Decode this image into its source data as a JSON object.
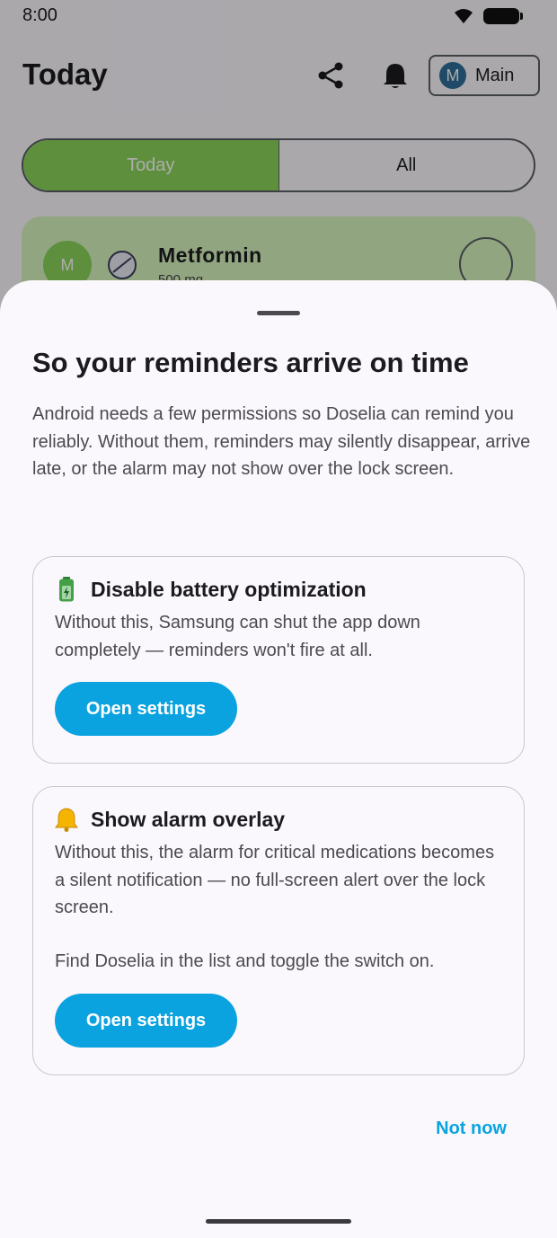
{
  "status_bar": {
    "time": "8:00"
  },
  "header": {
    "title": "Today",
    "profile_initial": "M",
    "profile_label": "Main"
  },
  "tabs": [
    {
      "label": "Today",
      "active": true
    },
    {
      "label": "All",
      "active": false
    }
  ],
  "medication": {
    "avatar_initial": "M",
    "name": "Metformin",
    "dose": "500 mg"
  },
  "sheet": {
    "title": "So your reminders arrive on time",
    "intro": "Android needs a few permissions so Doselia can remind you reliably. Without them, reminders may silently disappear, arrive late, or the alarm may not show over the lock screen.",
    "cards": [
      {
        "icon": "battery-icon",
        "title": "Disable battery optimization",
        "description": "Without this, Samsung can shut the app down completely — reminders won't fire at all.",
        "button_label": "Open settings"
      },
      {
        "icon": "bell-icon",
        "title": "Show alarm overlay",
        "description": "Without this, the alarm for critical medications becomes a silent notification — no full-screen alert over the lock screen.",
        "hint": "Find Doselia in the list and toggle the switch on.",
        "button_label": "Open settings"
      }
    ],
    "dismiss_label": "Not now"
  },
  "colors": {
    "accent": "#0aa3e0",
    "active_tab": "#8bd35a",
    "card_bg": "#d6f3bd"
  }
}
